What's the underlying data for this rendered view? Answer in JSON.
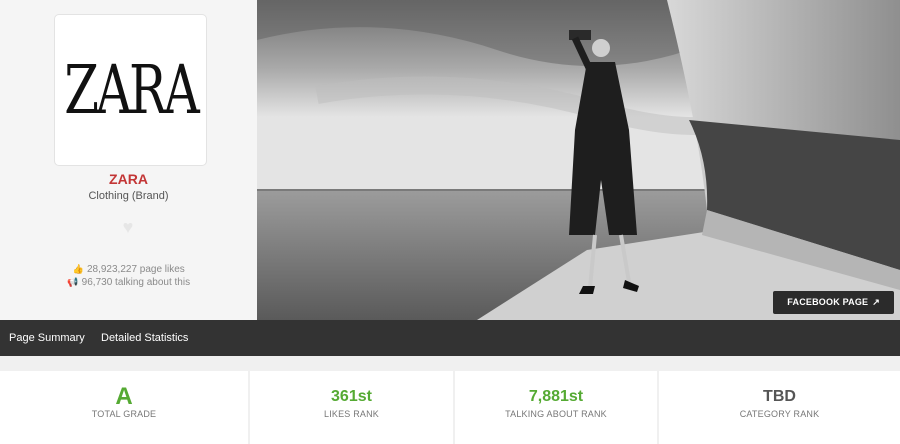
{
  "profile": {
    "logo_text": "ZARA",
    "brand_name": "ZARA",
    "category": "Clothing (Brand)",
    "page_likes": "28,923,227 page likes",
    "talking_about": "96,730 talking about this"
  },
  "cover": {
    "facebook_button": "FACEBOOK PAGE"
  },
  "nav": {
    "items": [
      "Page Summary",
      "Detailed Statistics"
    ]
  },
  "stats": [
    {
      "value": "A",
      "label": "TOTAL GRADE"
    },
    {
      "value": "361st",
      "label": "LIKES RANK"
    },
    {
      "value": "7,881st",
      "label": "TALKING ABOUT RANK"
    },
    {
      "value": "TBD",
      "label": "CATEGORY RANK"
    }
  ],
  "colors": {
    "brand_name": "#c33636",
    "rank_green": "#55aa33",
    "nav_bg": "#333333"
  },
  "icons": {
    "likes": "thumbs-up-icon",
    "talking": "megaphone-icon",
    "favorite": "heart-icon",
    "external": "external-link-icon"
  }
}
